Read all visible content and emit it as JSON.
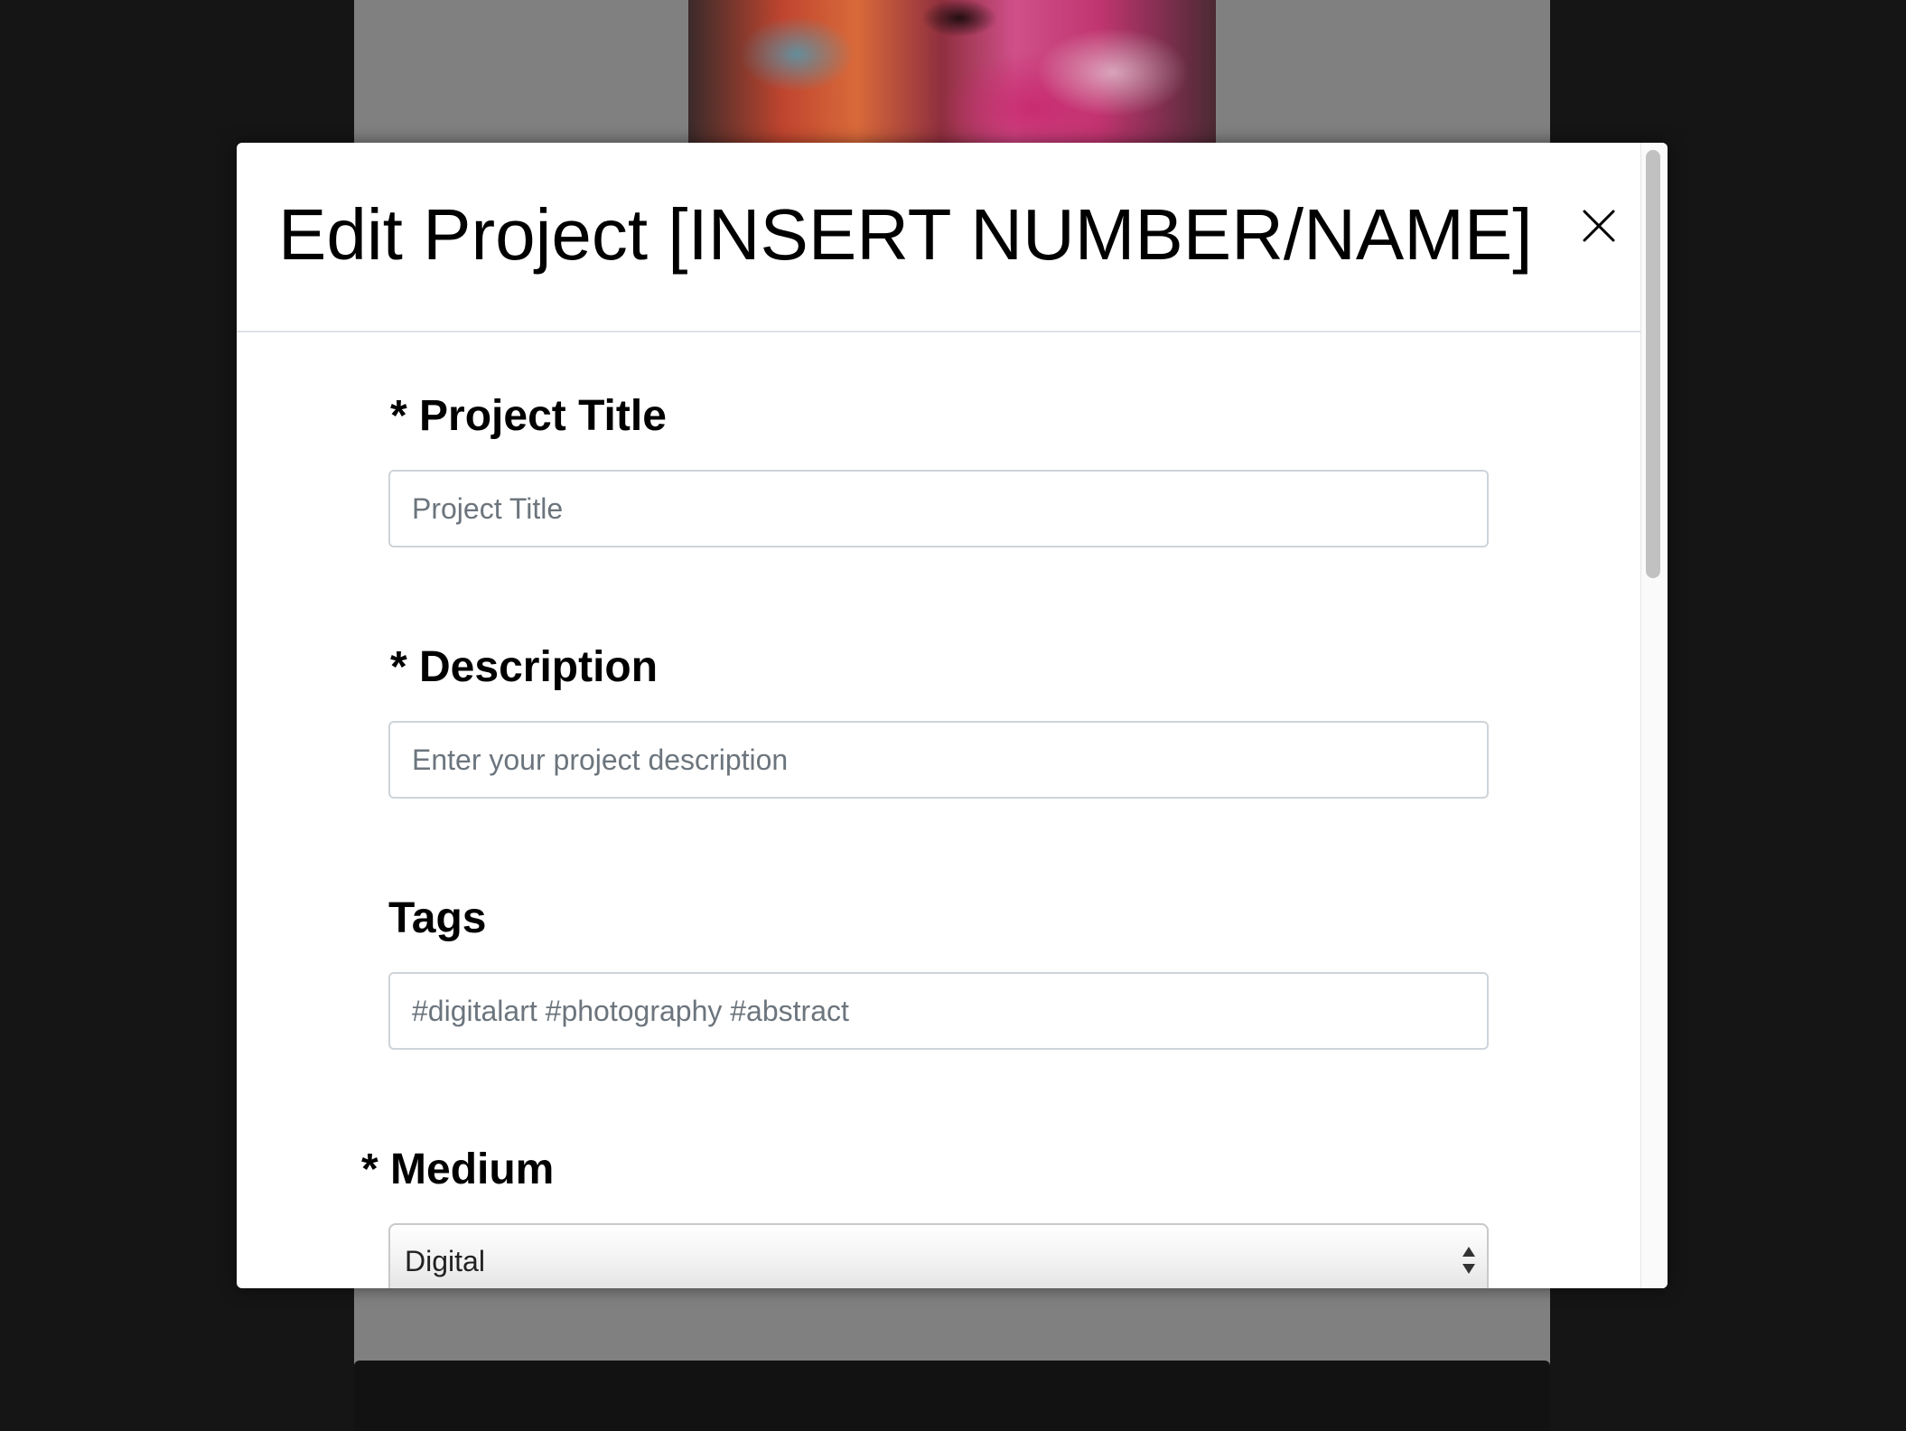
{
  "modal": {
    "title": "Edit Project [INSERT NUMBER/NAME]",
    "close_icon": "close-icon"
  },
  "form": {
    "project_title": {
      "label": "* Project Title",
      "placeholder": "Project Title",
      "value": ""
    },
    "description": {
      "label": "* Description",
      "placeholder": "Enter your project description",
      "value": ""
    },
    "tags": {
      "label": "Tags",
      "placeholder": "#digitalart #photography #abstract",
      "value": ""
    },
    "medium": {
      "label": "* Medium",
      "selected": "Digital",
      "arrow_icon": "select-arrows-icon"
    }
  },
  "colors": {
    "overlay": "#808080",
    "backdrop": "#151515",
    "modal_bg": "#ffffff",
    "input_border": "#ced4da",
    "placeholder_text": "#6c757d"
  }
}
